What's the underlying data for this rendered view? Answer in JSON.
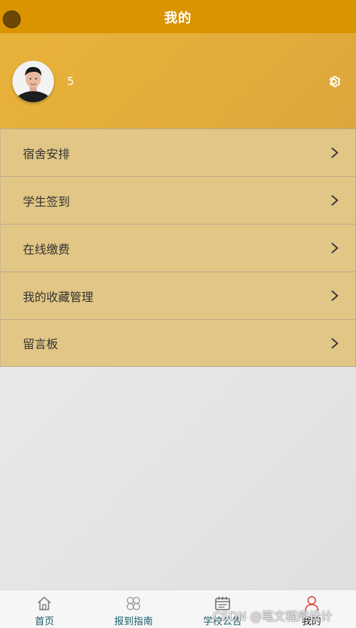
{
  "header": {
    "title": "我的"
  },
  "profile": {
    "username": "5",
    "avatar_icon": "person-photo",
    "settings_icon": "gear-icon"
  },
  "menu": {
    "items": [
      {
        "label": "宿舍安排",
        "icon": "chevron-right-icon"
      },
      {
        "label": "学生签到",
        "icon": "chevron-right-icon"
      },
      {
        "label": "在线缴费",
        "icon": "chevron-right-icon"
      },
      {
        "label": "我的收藏管理",
        "icon": "chevron-right-icon"
      },
      {
        "label": "留言板",
        "icon": "chevron-right-icon"
      }
    ]
  },
  "tabbar": {
    "tabs": [
      {
        "label": "首页",
        "icon": "home-icon"
      },
      {
        "label": "报到指南",
        "icon": "grid-knot-icon"
      },
      {
        "label": "学校公告",
        "icon": "calendar-icon"
      },
      {
        "label": "我的",
        "icon": "user-icon"
      }
    ],
    "active_index": 3
  },
  "watermark": "CSDN @笔文程序设计",
  "colors": {
    "topbar": "#d99400",
    "profile_bg": "#e3ac3b",
    "menu_bg": "#e1c685",
    "tab_label": "#1e5f6b",
    "active_icon": "#d9534f"
  }
}
